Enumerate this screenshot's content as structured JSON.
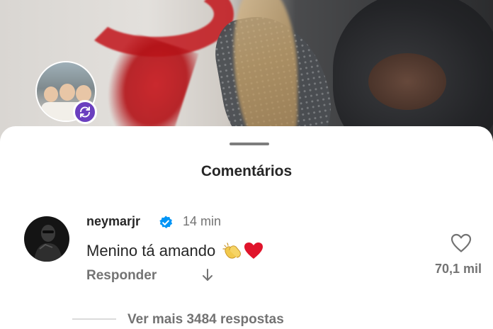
{
  "sheet": {
    "title": "Comentários"
  },
  "comment": {
    "username": "neymarjr",
    "verified_icon": "verified-badge-icon",
    "time": "14 min",
    "text": "Menino tá amando",
    "emojis": [
      "clapping-hands-icon",
      "red-heart-icon"
    ],
    "reply_label": "Responder",
    "like_count": "70,1 mil",
    "more_replies": "Ver mais 3484 respostas"
  },
  "colors": {
    "verified": "#0095f6",
    "repost_badge": "#6b3fbf",
    "heart_emoji": "#e0142b",
    "secondary_text": "#737373"
  }
}
